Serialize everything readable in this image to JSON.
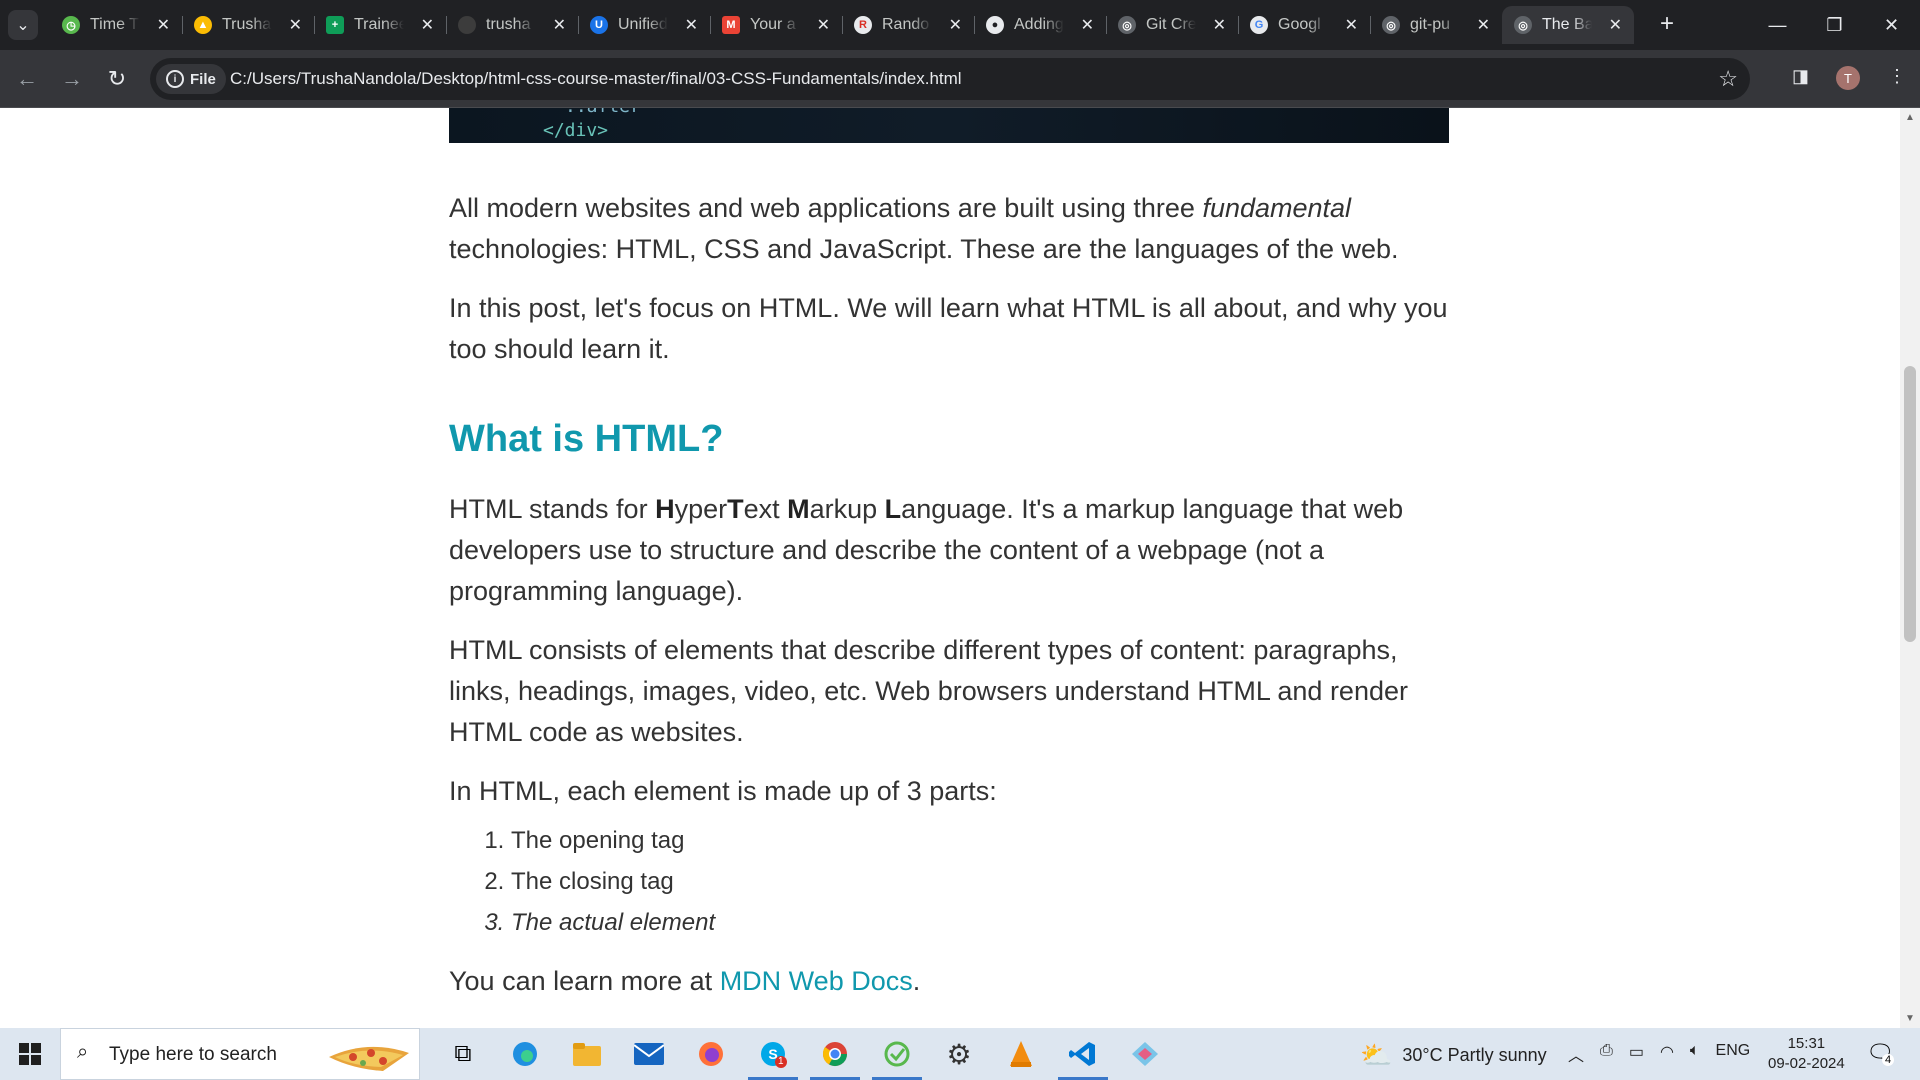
{
  "browser": {
    "tabs": [
      {
        "title": "Time T",
        "favicon_color": "#58b84d",
        "favicon_glyph": "◷"
      },
      {
        "title": "Trusha",
        "favicon_color": "#fbbc04",
        "favicon_glyph": "▲"
      },
      {
        "title": "Trainee",
        "favicon_color": "#0f9d58",
        "favicon_glyph": "+"
      },
      {
        "title": "trusha",
        "favicon_color": "#3c3c3c",
        "favicon_glyph": ""
      },
      {
        "title": "Unified",
        "favicon_color": "#1a73e8",
        "favicon_glyph": "U"
      },
      {
        "title": "Your a",
        "favicon_color": "#ea4335",
        "favicon_glyph": "M"
      },
      {
        "title": "Rando",
        "favicon_color": "#e8eaed",
        "favicon_glyph": "R"
      },
      {
        "title": "Adding",
        "favicon_color": "#e8eaed",
        "favicon_glyph": "●"
      },
      {
        "title": "Git Cre",
        "favicon_color": "#9aa0a6",
        "favicon_glyph": "◎"
      },
      {
        "title": "Googl",
        "favicon_color": "#e8eaed",
        "favicon_glyph": "G"
      },
      {
        "title": "git-pu",
        "favicon_color": "#9aa0a6",
        "favicon_glyph": "◎"
      },
      {
        "title": "The Ba",
        "favicon_color": "#9aa0a6",
        "favicon_glyph": "◎",
        "active": true
      }
    ],
    "close_glyph": "✕",
    "new_tab_glyph": "+",
    "address_chip": "File",
    "url": "C:/Users/TrushaNandola/Desktop/html-css-course-master/final/03-CSS-Fundamentals/index.html",
    "profile_initial": "T"
  },
  "page": {
    "code": {
      "line1": "::after",
      "line2": "</div>"
    },
    "intro_p1_a": "All modern websites and web applications are built using three ",
    "intro_p1_em": "fundamental",
    "intro_p1_b": " technologies: HTML, CSS and JavaScript. These are the languages of the web.",
    "intro_p2": "In this post, let's focus on HTML. We will learn what HTML is all about, and why you too should learn it.",
    "heading": "What is HTML?",
    "p3": {
      "a": "HTML stands for ",
      "H": "H",
      "yper": "yper",
      "T": "T",
      "ext": "ext ",
      "M": "M",
      "arkup": "arkup ",
      "L": "L",
      "rest": "anguage. It's a markup language that web developers use to structure and describe the content of a webpage (not a programming language)."
    },
    "p4": "HTML consists of elements that describe different types of content: paragraphs, links, headings, images, video, etc. Web browsers understand HTML and render HTML code as websites.",
    "p5": "In HTML, each element is made up of 3 parts:",
    "list": [
      "The opening tag",
      "The closing tag",
      "The actual element"
    ],
    "p6_a": "You can learn more at ",
    "p6_link": "MDN Web Docs",
    "p6_b": ".",
    "link_color": "#1098ad"
  },
  "taskbar": {
    "search_placeholder": "Type here to search",
    "apps": [
      "task-view",
      "edge",
      "file-explorer",
      "mail",
      "firefox",
      "skype",
      "chrome",
      "time-tracker",
      "settings",
      "vlc",
      "vscode",
      "git-kraken"
    ],
    "skype_badge": "1",
    "weather": "30°C  Partly sunny",
    "language": "ENG",
    "time": "15:31",
    "date": "09-02-2024",
    "notification_count": "4"
  }
}
